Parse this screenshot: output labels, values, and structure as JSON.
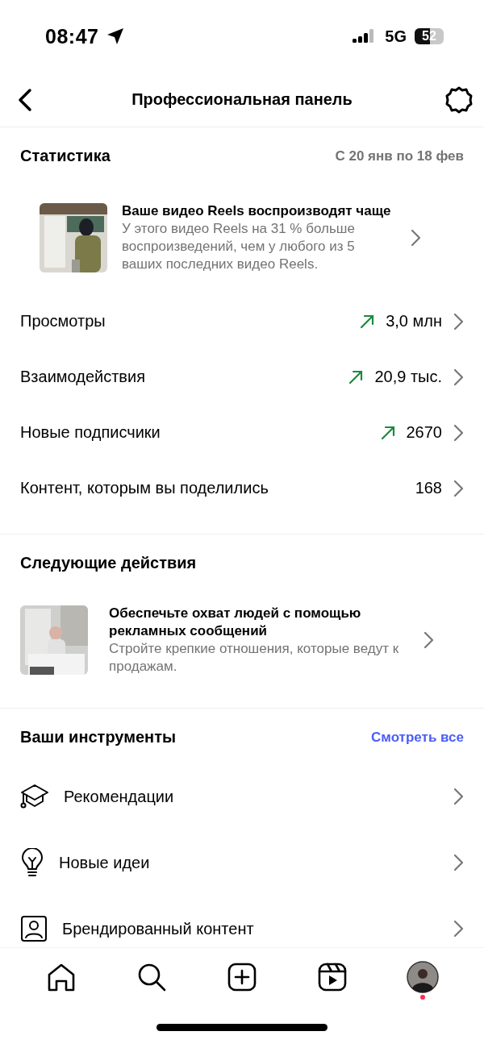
{
  "status_bar": {
    "time": "08:47",
    "network": "5G",
    "battery": "52"
  },
  "header": {
    "title": "Профессиональная панель"
  },
  "statistics": {
    "title": "Статистика",
    "period": "С 20 янв по 18 фев",
    "highlight": {
      "title": "Ваше видео Reels воспроизводят чаще",
      "text": "У этого видео Reels на 31 % больше воспроизведений, чем у любого из 5 ваших последних видео Reels."
    },
    "rows": [
      {
        "label": "Просмотры",
        "value": "3,0 млн",
        "trend_up": true
      },
      {
        "label": "Взаимодействия",
        "value": "20,9 тыс.",
        "trend_up": true
      },
      {
        "label": "Новые подписчики",
        "value": "2670",
        "trend_up": true
      },
      {
        "label": "Контент, которым вы поделились",
        "value": "168",
        "trend_up": false
      }
    ]
  },
  "next_actions": {
    "title": "Следующие действия",
    "card": {
      "title": "Обеспечьте охват людей с помощью рекламных сообщений",
      "text": "Стройте крепкие отношения, которые ведут к продажам."
    }
  },
  "tools": {
    "title": "Ваши инструменты",
    "see_all": "Смотреть все",
    "items": [
      {
        "kind": "cap",
        "label": "Рекомендации"
      },
      {
        "kind": "bulb",
        "label": "Новые идеи"
      },
      {
        "kind": "badge",
        "label": "Брендированный контент"
      }
    ]
  },
  "bottom_nav": [
    {
      "kind": "home"
    },
    {
      "kind": "search"
    },
    {
      "kind": "create"
    },
    {
      "kind": "reels"
    },
    {
      "kind": "profile",
      "notification": true
    }
  ]
}
